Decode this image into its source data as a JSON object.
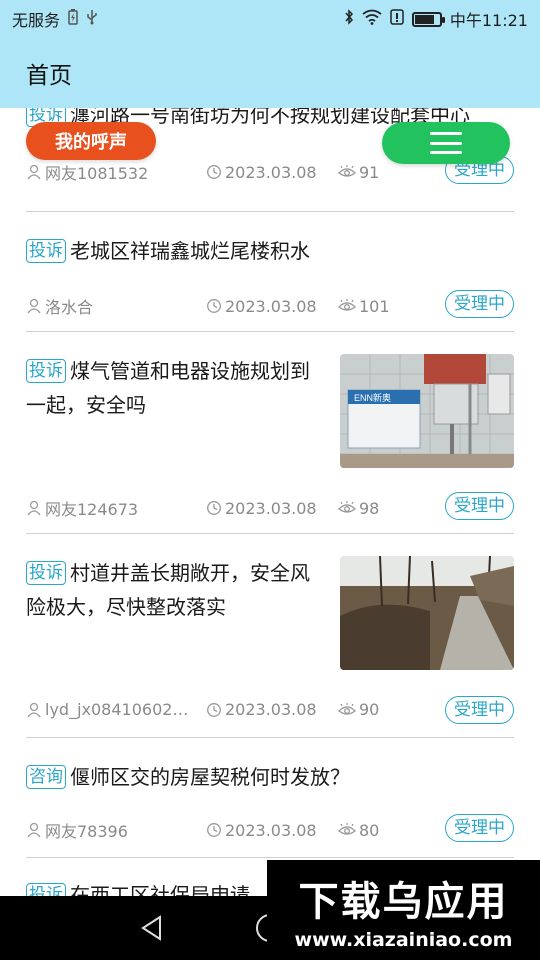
{
  "status_bar": {
    "carrier": "无服务",
    "time": "中午11:21",
    "battery_level": 0.8,
    "icons": [
      "battery-charging-icon",
      "usb-icon",
      "bluetooth-icon",
      "wifi-icon",
      "alert-icon",
      "battery-icon"
    ]
  },
  "header": {
    "title": "首页"
  },
  "voice_button": {
    "label": "我的呼声"
  },
  "menu_button": {
    "icon": "menu-icon"
  },
  "items": [
    {
      "tag": "投诉",
      "title": "瀍河路一号南街坊为何不按规划建设配套中心",
      "user": "网友1081532",
      "date": "2023.03.08",
      "views": "91",
      "status": "受理中",
      "has_image": false
    },
    {
      "tag": "投诉",
      "title": "老城区祥瑞鑫城烂尾楼积水",
      "user": "洛水合",
      "date": "2023.03.08",
      "views": "101",
      "status": "受理中",
      "has_image": false
    },
    {
      "tag": "投诉",
      "title": "煤气管道和电器设施规划到一起，安全吗",
      "user": "网友124673",
      "date": "2023.03.08",
      "views": "98",
      "status": "受理中",
      "has_image": true,
      "image_text": "ENN新奥"
    },
    {
      "tag": "投诉",
      "title": "村道井盖长期敞开，安全风险极大，尽快整改落实",
      "user": "lyd_jx08410602…",
      "date": "2023.03.08",
      "views": "90",
      "status": "受理中",
      "has_image": true
    },
    {
      "tag": "咨询",
      "title": "偃师区交的房屋契税何时发放？",
      "user": "网友78396",
      "date": "2023.03.08",
      "views": "80",
      "status": "受理中",
      "has_image": false
    },
    {
      "tag": "投诉",
      "title": "在西工区社保局申请",
      "has_image": false
    }
  ],
  "watermark": {
    "brand": "下载乌应用",
    "url": "www.xiazainiao.com"
  },
  "colors": {
    "header_bg": "#aee6f7",
    "accent": "#2aa6c9",
    "voice_button": "#e8501e",
    "menu_button": "#22c35e"
  }
}
